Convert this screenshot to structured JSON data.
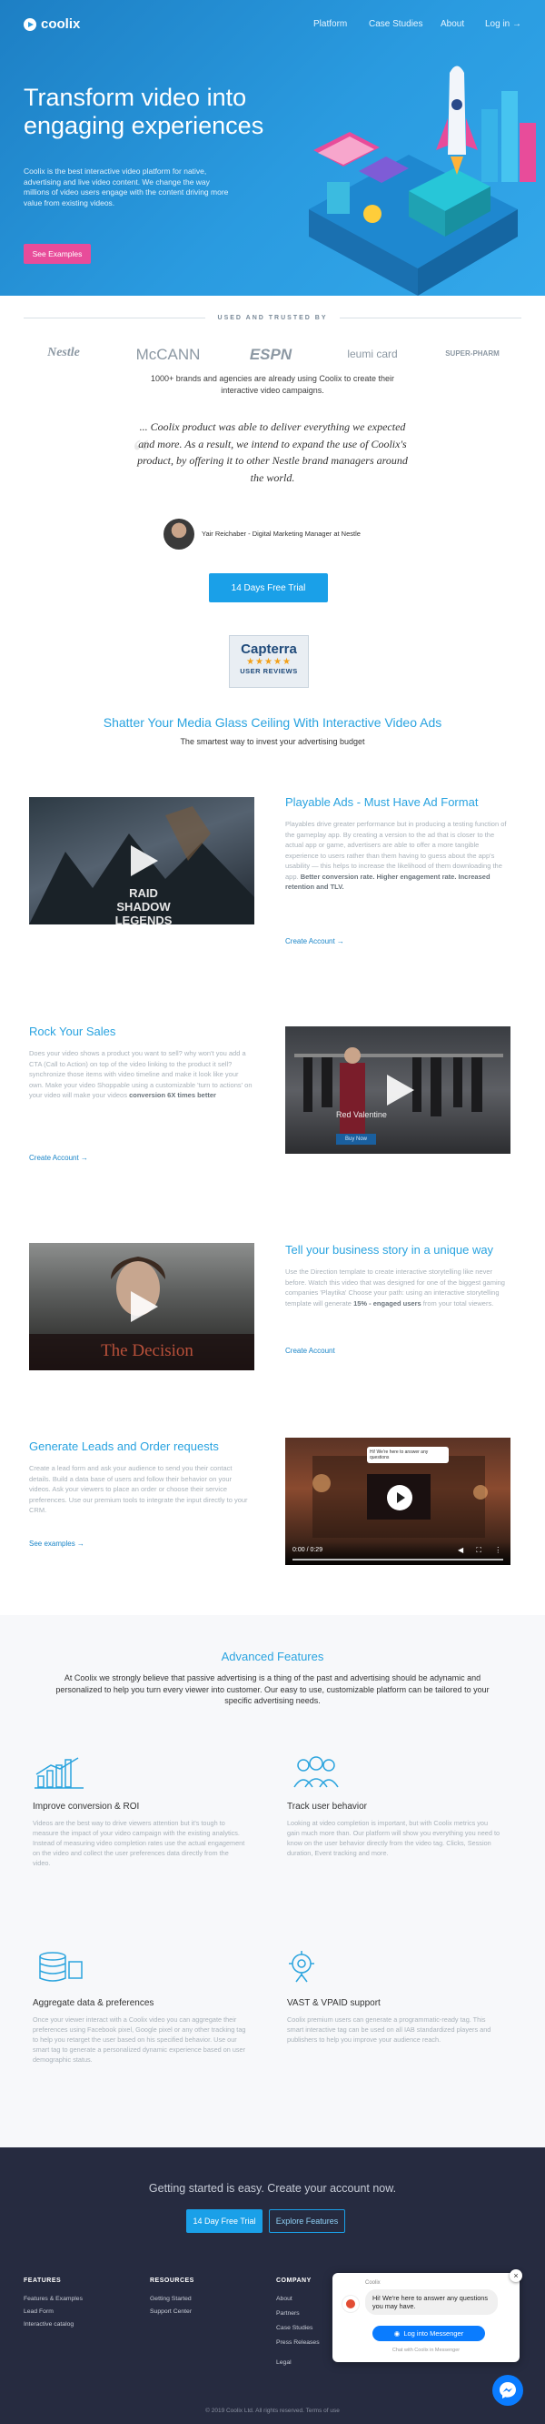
{
  "nav": {
    "logo": "coolix",
    "links": [
      "Platform",
      "Case Studies",
      "About",
      "Log in →"
    ]
  },
  "hero": {
    "title": "Transform video into engaging experiences",
    "description": "Coolix is the best interactive video platform for native, advertising and live video content. We change the way millions of video users engage with the content driving more value from existing videos.",
    "button": "See Examples"
  },
  "trusted": {
    "heading": "USED AND TRUSTED BY",
    "brands": [
      "Nestle",
      "McCANN",
      "ESPN",
      "leumi card",
      "SUPER-PHARM"
    ],
    "subtitle": "1000+ brands and agencies are already using Coolix to create their interactive video campaigns."
  },
  "testimonial": {
    "quote": "... Coolix product was able to deliver everything we expected and more. As a result, we intend to expand the use of Coolix's product, by offering it to other Nestle brand managers around the world.",
    "author": "Yair Reichaber - Digital Marketing Manager at Nestle"
  },
  "cta": {
    "trial_button": "14 Days Free Trial"
  },
  "capterra": {
    "name": "Capterra",
    "stars": "★★★★★",
    "label": "USER REVIEWS"
  },
  "shatter": {
    "title": "Shatter Your Media Glass Ceiling With Interactive Video Ads",
    "subtitle": "The smartest way to invest your advertising budget"
  },
  "sections": [
    {
      "title": "Playable Ads - Must Have Ad Format",
      "text_plain": "Playables drive greater performance but in producing a testing function of the gameplay app. By creating a version to the ad that is closer to the actual app or game, advertisers are able to offer a more tangible experience to users rather than them having to guess about the app's usability — this helps to increase the likelihood of them downloading the app.",
      "text_bold": "Better conversion rate. Higher engagement rate. Increased retention and TLV.",
      "link": "Create Account →",
      "video_caption": "RAID SHADOW LEGENDS"
    },
    {
      "title": "Rock Your Sales",
      "text_plain": "Does your video shows a product you want to sell? why won't you add a CTA (Call to Action) on top of the video linking to the product it sell? synchronize those items with video timeline and make it look like your own. Make your video Shoppable using a customizable 'turn to actions' on your video will make your videos",
      "text_bold": "conversion 6X times better",
      "link": "Create Account →",
      "video_caption": "Red Valentine",
      "video_button": "Buy Now"
    },
    {
      "title": "Tell your business story in a unique way",
      "text_plain": "Use the Direction template to create interactive storytelling like never before. Watch this video that was designed for one of the biggest gaming companies 'Playtika' Choose your path: using an interactive storytelling template will generate",
      "text_bold": "15% - engaged users",
      "text_tail": " from your total viewers.",
      "link": "Create Account",
      "video_caption": "The Decision"
    },
    {
      "title": "Generate Leads and Order requests",
      "text_plain": "Create a lead form and ask your audience to send you their contact details. Build a data base of users and follow their behavior on your videos. Ask your viewers to place an order or choose their service preferences. Use our premium tools to integrate the input directly to your CRM.",
      "link": "See examples →",
      "video_time": "0:00 / 0:29",
      "video_popup": "Hi! We're here to answer any questions"
    }
  ],
  "advanced": {
    "title": "Advanced Features",
    "description": "At Coolix we strongly believe that passive advertising is a thing of the past and advertising should be adynamic and personalized to help you turn every viewer into customer. Our easy to use, customizable platform can be tailored to your specific advertising needs.",
    "features": [
      {
        "icon": "chart-icon",
        "title": "Improve conversion & ROI",
        "text": "Videos are the best way to drive viewers attention but it's tough to measure the impact of your video campaign with the existing analytics. Instead of measuring video completion rates use the actual engagement on the video and collect the user preferences data directly from the video."
      },
      {
        "icon": "users-icon",
        "title": "Track user behavior",
        "text": "Looking at video completion is important, but with Coolix metrics you gain much more than. Our platform will show you everything you need to know on the user behavior directly from the video tag. Clicks, Session duration, Event tracking and more."
      },
      {
        "icon": "database-icon",
        "title": "Aggregate data & preferences",
        "text": "Once your viewer interact with a Coolix video you can aggregate their preferences using Facebook pixel, Google pixel or any other tracking tag to help you retarget the user based on his specified behavior. Use our smart tag to generate a personalized dynamic experience based on user demographic status."
      },
      {
        "icon": "vast-icon",
        "title": "VAST & VPAID support",
        "text": "Coolix premium users can generate a programmatic-ready tag. This smart interactive tag can be used on all IAB standardized players and publishers to help you improve your audience reach."
      }
    ]
  },
  "footer_cta": {
    "title": "Getting started is easy. Create your account now.",
    "trial": "14 Day Free Trial",
    "explore": "Explore Features"
  },
  "footer": {
    "columns": [
      {
        "heading": "FEATURES",
        "items": [
          "Features & Examples",
          "Lead Form",
          "Interactive catalog"
        ]
      },
      {
        "heading": "RESOURCES",
        "items": [
          "Getting Started",
          "Support Center"
        ]
      },
      {
        "heading": "COMPANY",
        "items": [
          "About",
          "Partners",
          "Case Studies",
          "Press Releases",
          "Legal"
        ]
      }
    ],
    "copyright": "© 2019 Coolix Ltd. All rights reserved. Terms of use"
  },
  "chat": {
    "name": "Coolix",
    "message": "Hi! We're here to answer any questions you may have.",
    "button": "Log into Messenger",
    "small": "Chat with Coolix in Messenger",
    "close": "×"
  },
  "colors": {
    "accent": "#29a3e0",
    "hero": "#2a9be0",
    "pink": "#e84c9a",
    "footer": "#262b40",
    "messenger": "#0a7cff"
  }
}
